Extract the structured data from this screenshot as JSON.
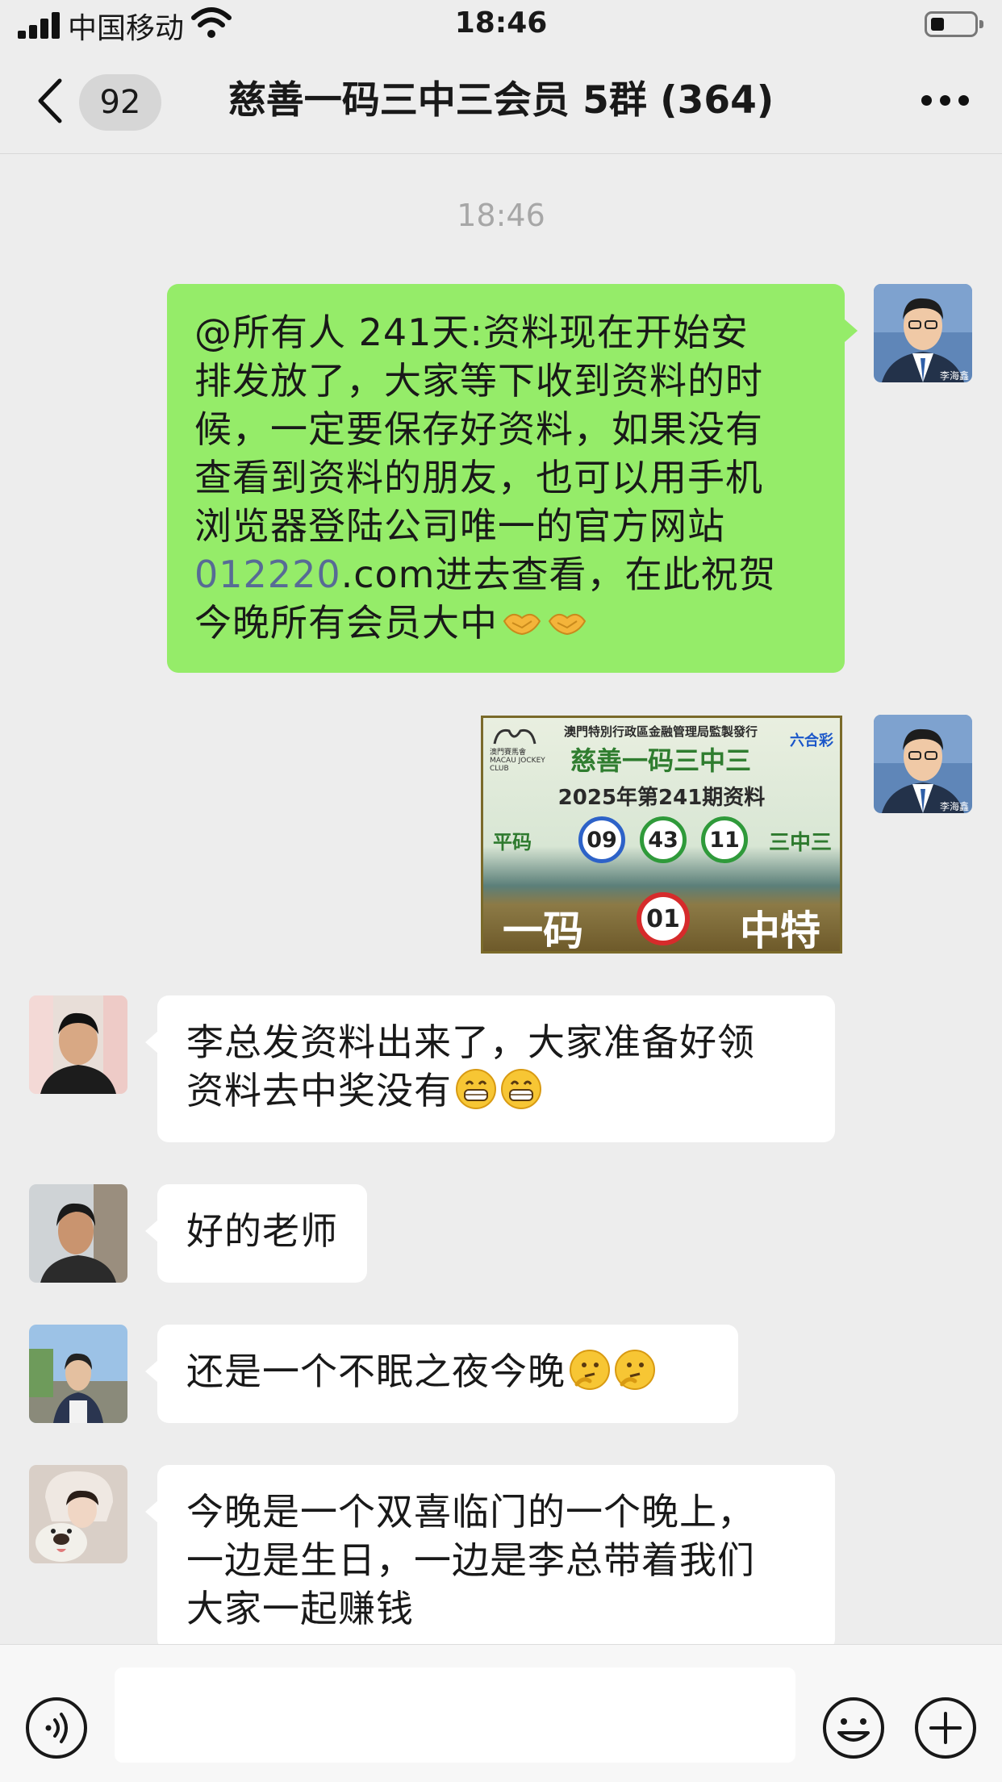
{
  "status_bar": {
    "carrier": "中国移动",
    "time": "18:46"
  },
  "nav": {
    "back_count": "92",
    "title": "慈善一码三中三会员 5群 (364)"
  },
  "timestamp": "18:46",
  "messages": [
    {
      "side": "right",
      "avatar_caption": "李海鑫",
      "line1": "@所有人 241天:资料现在开始安",
      "line2": "排发放了，大家等下收到资料的时",
      "line3": "候，一定要保存好资料，如果没有",
      "line4": "查看到资料的朋友，也可以用手机",
      "line5": "浏览器登陆公司唯一的官方网站",
      "link": "012220",
      "line6_rest": ".com进去查看，在此祝贺",
      "line7": "今晚所有会员大中"
    },
    {
      "side": "right",
      "avatar_caption": "李海鑫",
      "image": {
        "org": "澳門特別行政區金融管理局監製發行",
        "club_cn": "澳門賽馬會",
        "club_en": "MACAU JOCKEY CLUB",
        "brand": "六合彩",
        "name": "慈善一码三中三",
        "issue": "2025年第241期资料",
        "ping_label": "平码",
        "balls": [
          "09",
          "43",
          "11"
        ],
        "sanz_label": "三中三",
        "yima_label": "一码",
        "special_ball": "01",
        "zhong_label": "中特"
      }
    },
    {
      "side": "left",
      "line1": "李总发资料出来了，大家准备好领",
      "line2": "资料去中奖没有"
    },
    {
      "side": "left",
      "text": "好的老师"
    },
    {
      "side": "left",
      "text": "还是一个不眠之夜今晚"
    },
    {
      "side": "left",
      "line1": "今晚是一个双喜临门的一个晚上，",
      "line2": "一边是生日，一边是李总带着我们",
      "line3": "大家一起赚钱"
    }
  ],
  "colors": {
    "green_bubble": "#95ec69",
    "link": "#576b95",
    "background": "#ededed"
  },
  "icons": [
    "signal-icon",
    "wifi-icon",
    "battery-icon",
    "back-chevron-icon",
    "more-icon",
    "voice-icon",
    "emoji-icon",
    "plus-icon",
    "handshake-emoji",
    "grin-emoji",
    "thinking-emoji"
  ]
}
